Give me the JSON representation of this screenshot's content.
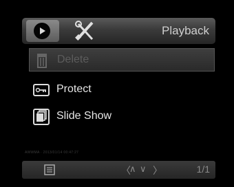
{
  "header": {
    "title": "Playback",
    "tabs": [
      {
        "name": "playback-tab",
        "icon": "play-icon",
        "active": true
      },
      {
        "name": "setup-tab",
        "icon": "wrench-screwdriver-icon",
        "active": false
      }
    ]
  },
  "menu": {
    "items": [
      {
        "label": "Delete",
        "icon": "trash-icon",
        "selected": true,
        "disabled": true
      },
      {
        "label": "Protect",
        "icon": "key-icon",
        "selected": false,
        "disabled": false
      },
      {
        "label": "Slide Show",
        "icon": "slideshow-icon",
        "selected": false,
        "disabled": false
      }
    ]
  },
  "status": {
    "info": "AWWMA · 2013/01/14 00:47:27"
  },
  "footer": {
    "display_icon": "display-icon",
    "nav_left": "〈",
    "nav_up": "∧",
    "nav_down": "∨",
    "nav_right": "〉",
    "page": "1/1"
  },
  "colors": {
    "background": "#000000",
    "text": "#e6e6e6",
    "disabled_text": "#5c5c5c",
    "bar": "#3a3a3a"
  }
}
